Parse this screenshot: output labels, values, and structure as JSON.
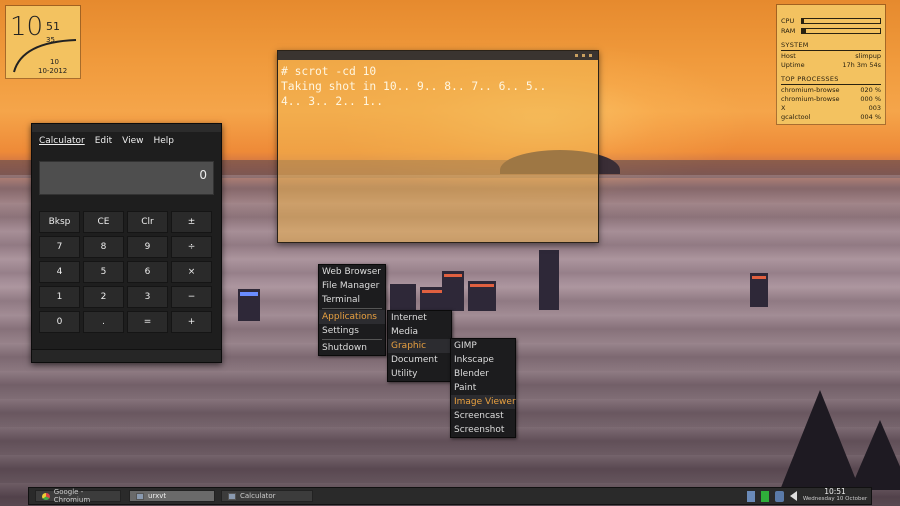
{
  "clock_widget": {
    "hour": "10",
    "minute": "51",
    "second": "35",
    "day": "10",
    "date": "10-2012"
  },
  "sysinfo": {
    "cpu_label": "CPU",
    "cpu_level": 0.02,
    "ram_label": "RAM",
    "ram_level": 0.05,
    "system_header": "SYSTEM",
    "host_label": "Host",
    "host_value": "slimpup",
    "uptime_label": "Uptime",
    "uptime_value": "17h 3m 54s",
    "processes_header": "TOP PROCESSES",
    "processes": [
      {
        "name": "chromium-browse",
        "value": "020 %"
      },
      {
        "name": "chromium-browse",
        "value": "000 %"
      },
      {
        "name": "X",
        "value": "003"
      },
      {
        "name": "gcalctool",
        "value": "004 %"
      }
    ]
  },
  "terminal": {
    "lines": [
      "# scrot -cd 10",
      "Taking shot in 10.. 9.. 8.. 7.. 6.. 5..",
      "4.. 3.. 2.. 1.."
    ]
  },
  "calculator": {
    "menu": [
      "Calculator",
      "Edit",
      "View",
      "Help"
    ],
    "display": "0",
    "keys": [
      "Bksp",
      "CE",
      "Clr",
      "±",
      "7",
      "8",
      "9",
      "÷",
      "4",
      "5",
      "6",
      "×",
      "1",
      "2",
      "3",
      "−",
      "0",
      ".",
      "=",
      "+"
    ]
  },
  "main_menu": {
    "items": [
      "Web Browser",
      "File Manager",
      "Terminal",
      "Applications",
      "Settings",
      "Shutdown"
    ]
  },
  "applications_menu": {
    "items": [
      "Internet",
      "Media",
      "Graphic",
      "Document",
      "Utility"
    ]
  },
  "graphic_menu": {
    "items": [
      "GIMP",
      "Inkscape",
      "Blender",
      "Paint",
      "Image Viewer",
      "Screencast",
      "Screenshot"
    ]
  },
  "taskbar": {
    "tasks": [
      {
        "label": "Google - Chromium",
        "icon": "chrome-icon"
      },
      {
        "label": "urxvt",
        "icon": "terminal-icon"
      },
      {
        "label": "Calculator",
        "icon": "calculator-icon"
      }
    ],
    "time": "10:51",
    "date": "Wednesday 10 October"
  },
  "colors": {
    "widget_bg": "#f3c260",
    "menu_highlight": "#e8a040",
    "panel_bg": "#2a2a2a"
  }
}
